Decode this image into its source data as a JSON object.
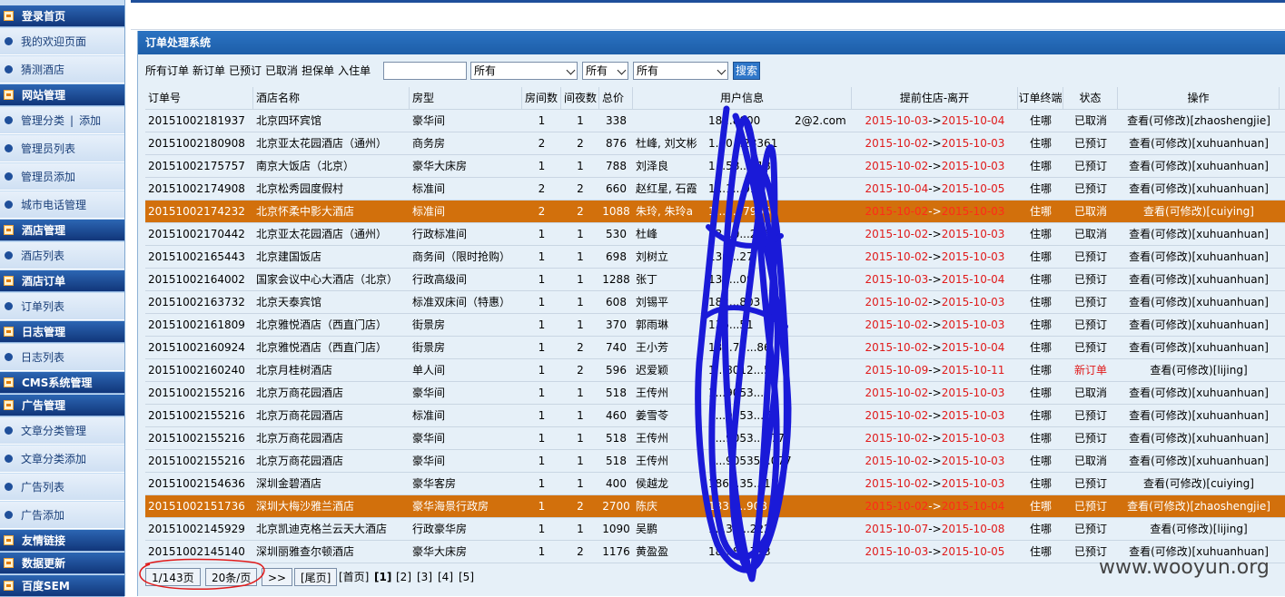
{
  "sidebar": [
    {
      "type": "header",
      "label": "登录首页"
    },
    {
      "type": "item",
      "label": "我的欢迎页面"
    },
    {
      "type": "item",
      "label": "猜测酒店"
    },
    {
      "type": "header",
      "label": "网站管理"
    },
    {
      "type": "item",
      "label": "管理分类",
      "extra": "添加"
    },
    {
      "type": "item",
      "label": "管理员列表"
    },
    {
      "type": "item",
      "label": "管理员添加"
    },
    {
      "type": "item",
      "label": "城市电话管理"
    },
    {
      "type": "header",
      "label": "酒店管理"
    },
    {
      "type": "item",
      "label": "酒店列表"
    },
    {
      "type": "header",
      "label": "酒店订单"
    },
    {
      "type": "item",
      "label": "订单列表"
    },
    {
      "type": "header",
      "label": "日志管理"
    },
    {
      "type": "item",
      "label": "日志列表"
    },
    {
      "type": "header",
      "label": "CMS系统管理"
    },
    {
      "type": "header",
      "label": "广告管理"
    },
    {
      "type": "item",
      "label": "文章分类管理"
    },
    {
      "type": "item",
      "label": "文章分类添加"
    },
    {
      "type": "item",
      "label": "广告列表"
    },
    {
      "type": "item",
      "label": "广告添加"
    },
    {
      "type": "header",
      "label": "友情链接"
    },
    {
      "type": "header",
      "label": "数据更新"
    },
    {
      "type": "header",
      "label": "百度SEM"
    }
  ],
  "panel": {
    "title": "订单处理系统"
  },
  "filters": {
    "links": [
      "所有订单",
      "新订单",
      "已预订",
      "已取消",
      "担保单",
      "入住单"
    ],
    "search_value": "",
    "select1": "所有",
    "select2": "所有",
    "select3": "所有",
    "search_label": "搜索"
  },
  "table": {
    "headers": [
      "订单号",
      "酒店名称",
      "房型",
      "房间数",
      "间夜数",
      "总价",
      "用户信息",
      "提前住店-离开",
      "订单终端",
      "状态",
      "操作"
    ],
    "rows": [
      {
        "id": "20151002181937",
        "hotel": "北京四环宾馆",
        "room": "豪华间",
        "rooms": "1",
        "nights": "1",
        "price": "338",
        "name": "",
        "phone": "18...8000",
        "email": "2@2.com",
        "start": "2015-10-03",
        "end": "2015-10-04",
        "term": "住哪",
        "status": "已取消",
        "op": "查看(可修改)[zhaoshengjie]",
        "hl": false
      },
      {
        "id": "20151002180908",
        "hotel": "北京亚太花园酒店（通州）",
        "room": "商务房",
        "rooms": "2",
        "nights": "2",
        "price": "876",
        "name": "杜峰, 刘文彬",
        "phone": "1...0...28361",
        "email": "",
        "start": "2015-10-02",
        "end": "2015-10-03",
        "term": "住哪",
        "status": "已预订",
        "op": "查看(可修改)[xuhuanhuan]",
        "hl": false
      },
      {
        "id": "20151002175757",
        "hotel": "南京大饭店（北京）",
        "room": "豪华大床房",
        "rooms": "1",
        "nights": "1",
        "price": "788",
        "name": "刘泽良",
        "phone": "1...58...018",
        "email": "",
        "start": "2015-10-02",
        "end": "2015-10-03",
        "term": "住哪",
        "status": "已预订",
        "op": "查看(可修改)[xuhuanhuan]",
        "hl": false
      },
      {
        "id": "20151002174908",
        "hotel": "北京松秀园度假村",
        "room": "标准间",
        "rooms": "2",
        "nights": "2",
        "price": "660",
        "name": "赵红星, 石霞",
        "phone": "1...1...013",
        "email": "",
        "start": "2015-10-04",
        "end": "2015-10-05",
        "term": "住哪",
        "status": "已预订",
        "op": "查看(可修改)[xuhuanhuan]",
        "hl": false
      },
      {
        "id": "20151002174232",
        "hotel": "北京怀柔中影大酒店",
        "room": "标准间",
        "rooms": "2",
        "nights": "2",
        "price": "1088",
        "name": "朱玲, 朱玲a",
        "phone": "1...0...79659",
        "email": "",
        "start": "2015-10-02",
        "end": "2015-10-03",
        "term": "住哪",
        "status": "已取消",
        "op": "查看(可修改)[cuiying]",
        "hl": true
      },
      {
        "id": "20151002170442",
        "hotel": "北京亚太花园酒店（通州）",
        "room": "行政标准间",
        "rooms": "1",
        "nights": "1",
        "price": "530",
        "name": "杜峰",
        "phone": "13...0...2561",
        "email": "",
        "start": "2015-10-02",
        "end": "2015-10-03",
        "term": "住哪",
        "status": "已取消",
        "op": "查看(可修改)[xuhuanhuan]",
        "hl": false
      },
      {
        "id": "20151002165443",
        "hotel": "北京建国饭店",
        "room": "商务间（限时抢购）",
        "rooms": "1",
        "nights": "1",
        "price": "698",
        "name": "刘树立",
        "phone": "130...27",
        "email": "",
        "start": "2015-10-02",
        "end": "2015-10-03",
        "term": "住哪",
        "status": "已预订",
        "op": "查看(可修改)[xuhuanhuan]",
        "hl": false
      },
      {
        "id": "20151002164002",
        "hotel": "国家会议中心大酒店（北京）",
        "room": "行政高级间",
        "rooms": "1",
        "nights": "1",
        "price": "1288",
        "name": "张丁",
        "phone": "132...09",
        "email": "",
        "start": "2015-10-03",
        "end": "2015-10-04",
        "term": "住哪",
        "status": "已预订",
        "op": "查看(可修改)[xuhuanhuan]",
        "hl": false
      },
      {
        "id": "20151002163732",
        "hotel": "北京天泰宾馆",
        "room": "标准双床间（特惠）",
        "rooms": "1",
        "nights": "1",
        "price": "608",
        "name": "刘锡平",
        "phone": "182...803",
        "email": "",
        "start": "2015-10-02",
        "end": "2015-10-03",
        "term": "住哪",
        "status": "已预订",
        "op": "查看(可修改)[xuhuanhuan]",
        "hl": false
      },
      {
        "id": "20151002161809",
        "hotel": "北京雅悦酒店（西直门店）",
        "room": "街景房",
        "rooms": "1",
        "nights": "1",
        "price": "370",
        "name": "郭雨琳",
        "phone": "136...51",
        "email": "",
        "start": "2015-10-02",
        "end": "2015-10-03",
        "term": "住哪",
        "status": "已预订",
        "op": "查看(可修改)[xuhuanhuan]",
        "hl": false
      },
      {
        "id": "20151002160924",
        "hotel": "北京雅悦酒店（西直门店）",
        "room": "街景房",
        "rooms": "1",
        "nights": "2",
        "price": "740",
        "name": "王小芳",
        "phone": "13...79...86",
        "email": "",
        "start": "2015-10-02",
        "end": "2015-10-04",
        "term": "住哪",
        "status": "已预订",
        "op": "查看(可修改)[xuhuanhuan]",
        "hl": false
      },
      {
        "id": "20151002160240",
        "hotel": "北京月桂树酒店",
        "room": "单人间",
        "rooms": "1",
        "nights": "2",
        "price": "596",
        "name": "迟爱颖",
        "phone": "1...8012...50",
        "email": "",
        "start": "2015-10-09",
        "end": "2015-10-11",
        "term": "住哪",
        "status": "新订单",
        "op": "查看(可修改)[lijing]",
        "hl": false
      },
      {
        "id": "20151002155216",
        "hotel": "北京万商花园酒店",
        "room": "豪华间",
        "rooms": "1",
        "nights": "1",
        "price": "518",
        "name": "王传州",
        "phone": "1...9053...77",
        "email": "",
        "start": "2015-10-02",
        "end": "2015-10-03",
        "term": "住哪",
        "status": "已取消",
        "op": "查看(可修改)[xuhuanhuan]",
        "hl": false
      },
      {
        "id": "20151002155216",
        "hotel": "北京万商花园酒店",
        "room": "标准间",
        "rooms": "1",
        "nights": "1",
        "price": "460",
        "name": "姜雪苓",
        "phone": "1...9053...77",
        "email": "",
        "start": "2015-10-02",
        "end": "2015-10-03",
        "term": "住哪",
        "status": "已预订",
        "op": "查看(可修改)[xuhuanhuan]",
        "hl": false
      },
      {
        "id": "20151002155216",
        "hotel": "北京万商花园酒店",
        "room": "豪华间",
        "rooms": "1",
        "nights": "1",
        "price": "518",
        "name": "王传州",
        "phone": "1...9053...077",
        "email": "",
        "start": "2015-10-02",
        "end": "2015-10-03",
        "term": "住哪",
        "status": "已预订",
        "op": "查看(可修改)[xuhuanhuan]",
        "hl": false
      },
      {
        "id": "20151002155216",
        "hotel": "北京万商花园酒店",
        "room": "豪华间",
        "rooms": "1",
        "nights": "1",
        "price": "518",
        "name": "王传州",
        "phone": "1...90535...077",
        "email": "",
        "start": "2015-10-02",
        "end": "2015-10-03",
        "term": "住哪",
        "status": "已取消",
        "op": "查看(可修改)[xuhuanhuan]",
        "hl": false
      },
      {
        "id": "20151002154636",
        "hotel": "深圳金碧酒店",
        "room": "豪华客房",
        "rooms": "1",
        "nights": "1",
        "price": "400",
        "name": "侯越龙",
        "phone": "186...35...15",
        "email": "",
        "start": "2015-10-02",
        "end": "2015-10-03",
        "term": "住哪",
        "status": "已预订",
        "op": "查看(可修改)[cuiying]",
        "hl": false
      },
      {
        "id": "20151002151736",
        "hotel": "深圳大梅沙雅兰酒店",
        "room": "豪华海景行政房",
        "rooms": "1",
        "nights": "2",
        "price": "2700",
        "name": "陈庆",
        "phone": "1331...908",
        "email": "",
        "start": "2015-10-02",
        "end": "2015-10-04",
        "term": "住哪",
        "status": "已预订",
        "op": "查看(可修改)[zhaoshengjie]",
        "hl": true
      },
      {
        "id": "20151002145929",
        "hotel": "北京凯迪克格兰云天大酒店",
        "room": "行政豪华房",
        "rooms": "1",
        "nights": "1",
        "price": "1090",
        "name": "吴鹏",
        "phone": "1...38...222",
        "email": "",
        "start": "2015-10-07",
        "end": "2015-10-08",
        "term": "住哪",
        "status": "已预订",
        "op": "查看(可修改)[lijing]",
        "hl": false
      },
      {
        "id": "20151002145140",
        "hotel": "深圳丽雅查尔顿酒店",
        "room": "豪华大床房",
        "rooms": "1",
        "nights": "2",
        "price": "1176",
        "name": "黄盈盈",
        "phone": "18...8...793",
        "email": "",
        "start": "2015-10-03",
        "end": "2015-10-05",
        "term": "住哪",
        "status": "已预订",
        "op": "查看(可修改)[xuhuanhuan]",
        "hl": false
      }
    ],
    "arrow": "->"
  },
  "pager": {
    "page_info": "1/143页",
    "per_page": "20条/页",
    "next": ">>",
    "last": "[尾页]",
    "first": "[首页]",
    "pages": [
      "[1]",
      "[2]",
      "[3]",
      "[4]",
      "[5]"
    ]
  },
  "watermark": "www.wooyun.org",
  "colors": {
    "accent": "#1d5ea9",
    "highlight_row": "#d2700c",
    "date_red": "#e01a1a",
    "scribble": "#1a1ad8",
    "circle": "#e01a1a"
  }
}
